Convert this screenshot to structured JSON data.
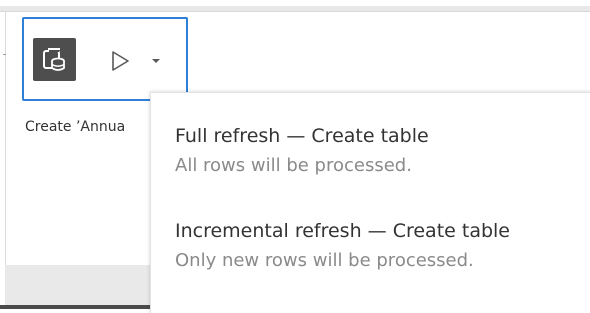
{
  "step": {
    "label": "Create ’Annua",
    "icon": "output-step-icon",
    "run_icon": "play-icon",
    "dropdown_icon": "caret-down-icon"
  },
  "menu": {
    "items": [
      {
        "title": "Full refresh — Create table",
        "description": "All rows will be processed."
      },
      {
        "title": "Incremental refresh — Create table",
        "description": "Only new rows will be processed."
      }
    ]
  },
  "colors": {
    "selection_border": "#2f7fd6",
    "icon_tile": "#4e4e4e",
    "text_primary": "#333333",
    "text_secondary": "#8a8a8a"
  }
}
